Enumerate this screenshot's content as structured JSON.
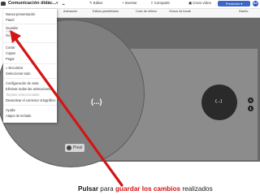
{
  "app": {
    "title": "Comunicación didác...",
    "caret": "▾"
  },
  "top_menu": {
    "edit": "Editar",
    "insert": "Insertar",
    "share": "Compartir",
    "create_video": "Crear vídeo",
    "present": "Presentar",
    "avatar": "AC"
  },
  "toolbar2": {
    "items": [
      "Animación",
      "Estilos predefinidos",
      "Color de relleno",
      "Grosor de borde",
      "Diseño"
    ]
  },
  "menu": {
    "group1": [
      "Nueva presentación",
      "Panel"
    ],
    "save": "Guardar",
    "save_shortcut_label": "Ctrl+S",
    "save_as": "Gu",
    "group2": [
      "Cortar",
      "Copiar",
      "Pegar"
    ],
    "group3": [
      "Encontrar",
      "Seleccionar todo"
    ],
    "group4": [
      "Configuración de vista",
      "Eliminar todas las animaciones",
      "Tarjetas seleccionadas",
      "Desactivar el corrector ortográfico"
    ],
    "group5": [
      "Ayuda",
      "Atajos de teclado"
    ]
  },
  "canvas": {
    "big_label": "(...)",
    "small_label": "(...)",
    "nav_up": "A",
    "nav_down": "1",
    "prezi_label": "Prezi"
  },
  "annotation": {
    "part1": "Pulsar",
    "part2": " para ",
    "part3": "guardar los cambios",
    "part4": " realizados",
    "color": "#d21515"
  }
}
